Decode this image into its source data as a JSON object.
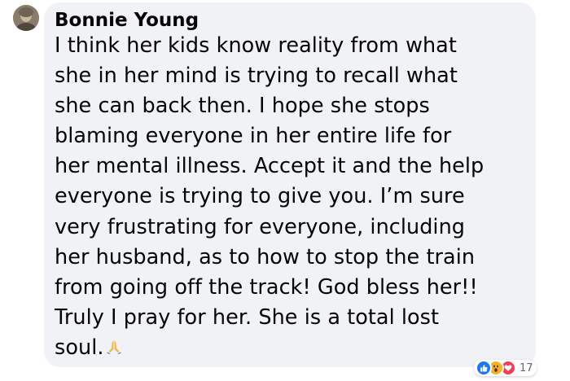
{
  "comment": {
    "author": "Bonnie Young",
    "lines": [
      "I think her kids know reality from what",
      "she in her mind is trying to recall what",
      "she can back then. I hope she stops",
      "blaming everyone in her entire life for",
      "her mental illness. Accept it and the help",
      "everyone is trying to give you. I’m sure",
      "very frustrating for everyone, including",
      "her husband, as to how to stop the train",
      "from going off the track! God bless her!!",
      "Truly I pray for her. She is a total lost",
      "soul."
    ],
    "trailing_emoji": "praying-hands-icon"
  },
  "reactions": {
    "icons": [
      "like-icon",
      "wow-icon",
      "love-icon"
    ],
    "count": "17"
  },
  "colors": {
    "bubble_bg": "#f0f2f5",
    "text": "#050505",
    "like": "#1877f2",
    "wow": "#f7b125",
    "love": "#f33e58",
    "count": "#65676b"
  }
}
